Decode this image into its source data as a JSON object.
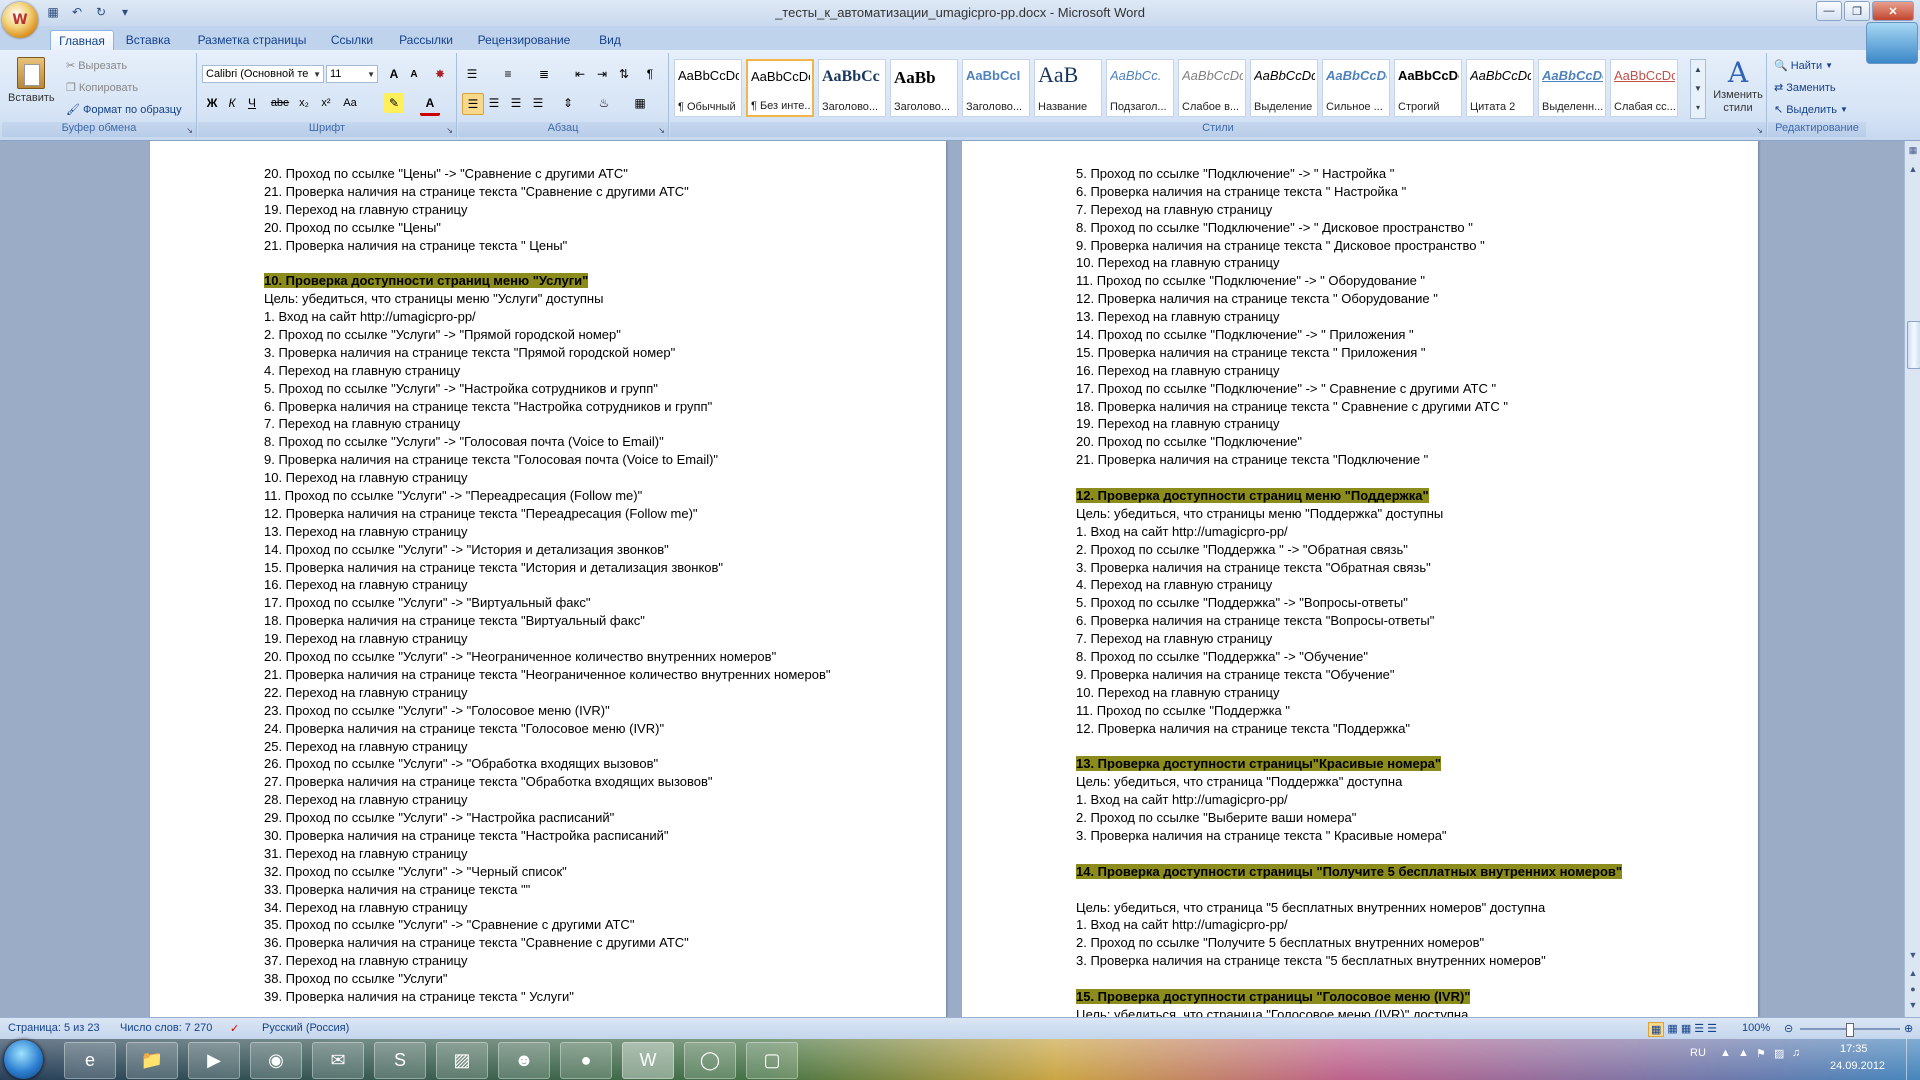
{
  "window": {
    "title": "_тесты_к_автоматизации_umagicpro-pp.docx - Microsoft Word",
    "office_logo": "W"
  },
  "ribbon": {
    "tabs": [
      "Главная",
      "Вставка",
      "Разметка страницы",
      "Ссылки",
      "Рассылки",
      "Рецензирование",
      "Вид"
    ],
    "clipboard": {
      "paste": "Вставить",
      "cut": "Вырезать",
      "copy": "Копировать",
      "format_painter": "Формат по образцу",
      "label": "Буфер обмена"
    },
    "font": {
      "name": "Calibri (Основной те",
      "size": "11",
      "label": "Шрифт",
      "bold": "Ж",
      "italic": "К",
      "underline": "Ч",
      "strike": "abe",
      "sub": "x₂",
      "sup": "x²",
      "case": "Aa",
      "grow": "A",
      "shrink": "A",
      "color_letter": "A"
    },
    "paragraph": {
      "label": "Абзац"
    },
    "styles": {
      "label": "Стили",
      "items": [
        {
          "sample": "AaBbCcDc",
          "name": "¶ Обычный"
        },
        {
          "sample": "AaBbCcDc",
          "name": "¶ Без инте..."
        },
        {
          "sample": "AaBbCc",
          "name": "Заголово..."
        },
        {
          "sample": "AaBb",
          "name": "Заголово..."
        },
        {
          "sample": "AaBbCcI",
          "name": "Заголово..."
        },
        {
          "sample": "AaB",
          "name": "Название"
        },
        {
          "sample": "AaBbCc.",
          "name": "Подзагол..."
        },
        {
          "sample": "AaBbCcDc",
          "name": "Слабое в..."
        },
        {
          "sample": "AaBbCcDc",
          "name": "Выделение"
        },
        {
          "sample": "AaBbCcDc",
          "name": "Сильное ..."
        },
        {
          "sample": "AaBbCcDc",
          "name": "Строгий"
        },
        {
          "sample": "AaBbCcDc",
          "name": "Цитата 2"
        },
        {
          "sample": "AaBbCcDc",
          "name": "Выделенн..."
        },
        {
          "sample": "AaBbCcDc",
          "name": "Слабая сс..."
        }
      ],
      "change_styles": "Изменить стили"
    },
    "editing": {
      "label": "Редактирование",
      "find": "Найти",
      "replace": "Заменить",
      "select": "Выделить"
    }
  },
  "document": {
    "left_page": [
      {
        "text": "20. Проход по ссылке \"Цены\" -> \"Сравнение с другими АТС\""
      },
      {
        "text": "21. Проверка наличия на странице текста \"Сравнение с другими АТС\""
      },
      {
        "text": "19. Переход на главную страницу"
      },
      {
        "text": "20. Проход по ссылке \"Цены\""
      },
      {
        "text": "21. Проверка наличия на странице текста \" Цены\""
      },
      {
        "text": ""
      },
      {
        "text": "10. Проверка доступности страниц меню \"Услуги\"",
        "head": true
      },
      {
        "text": "Цель: убедиться, что страницы меню \"Услуги\" доступны"
      },
      {
        "text": "1. Вход на сайт http://umagicpro-pp/"
      },
      {
        "text": "2. Проход по ссылке \"Услуги\" -> \"Прямой городской номер\""
      },
      {
        "text": "3. Проверка наличия на странице текста \"Прямой городской номер\""
      },
      {
        "text": "4. Переход на главную страницу"
      },
      {
        "text": "5. Проход по ссылке \"Услуги\" -> \"Настройка сотрудников и групп\""
      },
      {
        "text": "6. Проверка наличия на странице текста \"Настройка сотрудников и групп\""
      },
      {
        "text": "7. Переход на главную страницу"
      },
      {
        "text": "8. Проход по ссылке \"Услуги\" -> \"Голосовая почта (Voice to Email)\""
      },
      {
        "text": "9. Проверка наличия на странице текста \"Голосовая почта (Voice to Email)\""
      },
      {
        "text": "10. Переход на главную страницу"
      },
      {
        "text": "11. Проход по ссылке \"Услуги\" -> \"Переадресация (Follow me)\""
      },
      {
        "text": "12. Проверка наличия на странице текста \"Переадресация (Follow me)\""
      },
      {
        "text": "13. Переход на главную страницу"
      },
      {
        "text": "14. Проход по ссылке \"Услуги\" -> \"История и детализация звонков\""
      },
      {
        "text": "15. Проверка наличия на странице текста \"История и детализация звонков\""
      },
      {
        "text": "16. Переход на главную страницу"
      },
      {
        "text": "17. Проход по ссылке \"Услуги\" -> \"Виртуальный факс\""
      },
      {
        "text": "18. Проверка наличия на странице текста \"Виртуальный факс\""
      },
      {
        "text": "19. Переход на главную страницу"
      },
      {
        "text": "20. Проход по ссылке \"Услуги\" -> \"Неограниченное количество внутренних номеров\""
      },
      {
        "text": "21. Проверка наличия на странице текста \"Неограниченное количество внутренних номеров\""
      },
      {
        "text": "22. Переход на главную страницу"
      },
      {
        "text": "23. Проход по ссылке \"Услуги\" -> \"Голосовое меню (IVR)\""
      },
      {
        "text": "24. Проверка наличия на странице текста \"Голосовое меню (IVR)\""
      },
      {
        "text": "25. Переход на главную страницу"
      },
      {
        "text": "26. Проход по ссылке \"Услуги\" -> \"Обработка входящих вызовов\""
      },
      {
        "text": "27. Проверка наличия на странице текста \"Обработка входящих вызовов\""
      },
      {
        "text": "28. Переход на главную страницу"
      },
      {
        "text": "29. Проход по ссылке \"Услуги\" -> \"Настройка расписаний\""
      },
      {
        "text": "30. Проверка наличия на странице текста \"Настройка расписаний\""
      },
      {
        "text": "31. Переход на главную страницу"
      },
      {
        "text": "32. Проход по ссылке \"Услуги\" -> \"Черный список\""
      },
      {
        "text": "33. Проверка наличия на странице текста \"\""
      },
      {
        "text": "34. Переход на главную страницу"
      },
      {
        "text": "35. Проход по ссылке \"Услуги\" -> \"Сравнение с другими АТС\""
      },
      {
        "text": "36. Проверка наличия на странице текста \"Сравнение с другими АТС\""
      },
      {
        "text": "37. Переход на главную страницу"
      },
      {
        "text": "38. Проход по ссылке \"Услуги\""
      },
      {
        "text": "39. Проверка наличия на странице текста \" Услуги\""
      }
    ],
    "right_page": [
      {
        "text": "5. Проход по ссылке \"Подключение\" -> \" Настройка \""
      },
      {
        "text": "6. Проверка наличия на странице текста \" Настройка \""
      },
      {
        "text": "7. Переход на главную страницу"
      },
      {
        "text": "8. Проход по ссылке \"Подключение\" -> \" Дисковое пространство \""
      },
      {
        "text": "9. Проверка наличия на странице текста \" Дисковое пространство \""
      },
      {
        "text": "10. Переход на главную страницу"
      },
      {
        "text": "11. Проход по ссылке \"Подключение\" -> \" Оборудование \""
      },
      {
        "text": "12. Проверка наличия на странице текста \" Оборудование \""
      },
      {
        "text": "13. Переход на главную страницу"
      },
      {
        "text": "14. Проход по ссылке \"Подключение\" -> \" Приложения \""
      },
      {
        "text": "15. Проверка наличия на странице текста \" Приложения \""
      },
      {
        "text": "16. Переход на главную страницу"
      },
      {
        "text": "17. Проход по ссылке \"Подключение\" -> \" Сравнение с другими АТС \""
      },
      {
        "text": "18. Проверка наличия на странице текста \" Сравнение с другими АТС \""
      },
      {
        "text": "19. Переход на главную страницу"
      },
      {
        "text": "20. Проход по ссылке \"Подключение\""
      },
      {
        "text": "21. Проверка наличия на странице текста \"Подключение \""
      },
      {
        "text": ""
      },
      {
        "text": "12. Проверка доступности страниц меню \"Поддержка\"",
        "head": true
      },
      {
        "text": "Цель: убедиться, что страницы меню \"Поддержка\" доступны"
      },
      {
        "text": "1. Вход на сайт http://umagicpro-pp/"
      },
      {
        "text": "2. Проход по ссылке \"Поддержка \" -> \"Обратная связь\""
      },
      {
        "text": "3. Проверка наличия на странице текста \"Обратная связь\""
      },
      {
        "text": "4. Переход на главную страницу"
      },
      {
        "text": "5. Проход по ссылке \"Поддержка\" -> \"Вопросы-ответы\""
      },
      {
        "text": "6. Проверка наличия на странице текста \"Вопросы-ответы\""
      },
      {
        "text": "7. Переход на главную страницу"
      },
      {
        "text": "8. Проход по ссылке \"Поддержка\" -> \"Обучение\""
      },
      {
        "text": "9. Проверка наличия на странице текста \"Обучение\""
      },
      {
        "text": "10. Переход на главную страницу"
      },
      {
        "text": "11. Проход по ссылке \"Поддержка \""
      },
      {
        "text": "12. Проверка наличия на странице текста \"Поддержка\""
      },
      {
        "text": ""
      },
      {
        "text": "13. Проверка доступности страницы\"Красивые номера\"",
        "head": true
      },
      {
        "text": "Цель: убедиться, что страница \"Поддержка\" доступна"
      },
      {
        "text": "1. Вход на сайт http://umagicpro-pp/"
      },
      {
        "text": "2. Проход по ссылке \"Выберите ваши номера\""
      },
      {
        "text": "3. Проверка наличия на странице текста \" Красивые номера\""
      },
      {
        "text": ""
      },
      {
        "text": "14. Проверка доступности страницы \"Получите 5 бесплатных внутренних номеров\"",
        "head": true
      },
      {
        "text": ""
      },
      {
        "text": "Цель: убедиться, что страница \"5 бесплатных внутренних номеров\" доступна"
      },
      {
        "text": "1. Вход на сайт http://umagicpro-pp/"
      },
      {
        "text": "2. Проход по ссылке \"Получите 5 бесплатных внутренних номеров\""
      },
      {
        "text": "3. Проверка наличия на странице текста \"5 бесплатных внутренних номеров\""
      },
      {
        "text": ""
      },
      {
        "text": "15. Проверка доступности страницы \"Голосовое меню (IVR)\"",
        "head": true
      },
      {
        "text": "Цель: убедиться, что страница \"Голосовое меню (IVR)\" доступна"
      }
    ]
  },
  "statusbar": {
    "page": "Страница: 5 из 23",
    "words": "Число слов: 7 270",
    "language": "Русский (Россия)",
    "zoom": "100%"
  },
  "taskbar": {
    "lang": "RU",
    "time": "17:35",
    "date": "24.09.2012"
  },
  "colors": {
    "heading_highlight": "#8c8c1c",
    "ribbon_text": "#15428b"
  }
}
